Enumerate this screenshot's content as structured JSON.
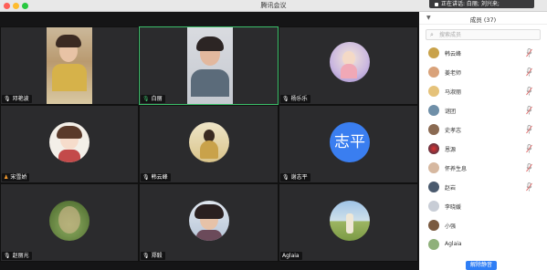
{
  "window": {
    "title": "腾讯会议"
  },
  "speaker_banner": {
    "text": "正在讲话: 白丽; 刘兴来;"
  },
  "tiles": [
    {
      "name": "邓艳波",
      "mic": "muted"
    },
    {
      "name": "白丽",
      "mic": "on"
    },
    {
      "name": "杨乐乐",
      "mic": "muted"
    },
    {
      "name": "宋雪娇",
      "mic": "muted"
    },
    {
      "name": "韩云峰",
      "mic": "muted"
    },
    {
      "name": "谢志平",
      "mic": "muted",
      "initials": "志平"
    },
    {
      "name": "赵丽光",
      "mic": "muted"
    },
    {
      "name": "郑毅",
      "mic": "muted"
    },
    {
      "name": "Aglaia",
      "mic": "muted"
    }
  ],
  "sidebar": {
    "collapse_icon": "triangle-down-icon",
    "title": "成员 (37)",
    "search_placeholder": "搜索成员",
    "members": [
      {
        "name": "韩云峰",
        "muted": true
      },
      {
        "name": "姜老师",
        "muted": true
      },
      {
        "name": "马淑丽",
        "muted": true
      },
      {
        "name": "谜团",
        "muted": true
      },
      {
        "name": "史孝志",
        "muted": true
      },
      {
        "name": "恩源",
        "muted": true
      },
      {
        "name": "怀养生息",
        "muted": true
      },
      {
        "name": "赵岩",
        "muted": true
      },
      {
        "name": "李晓媛",
        "muted": false
      },
      {
        "name": "小强",
        "muted": false
      },
      {
        "name": "Aglaia",
        "muted": false
      }
    ],
    "unmute_all_label": "解除静音"
  },
  "colors": {
    "accent": "#2f7ef5",
    "active_border": "#3cc06a",
    "muted_mic": "#e06666"
  }
}
